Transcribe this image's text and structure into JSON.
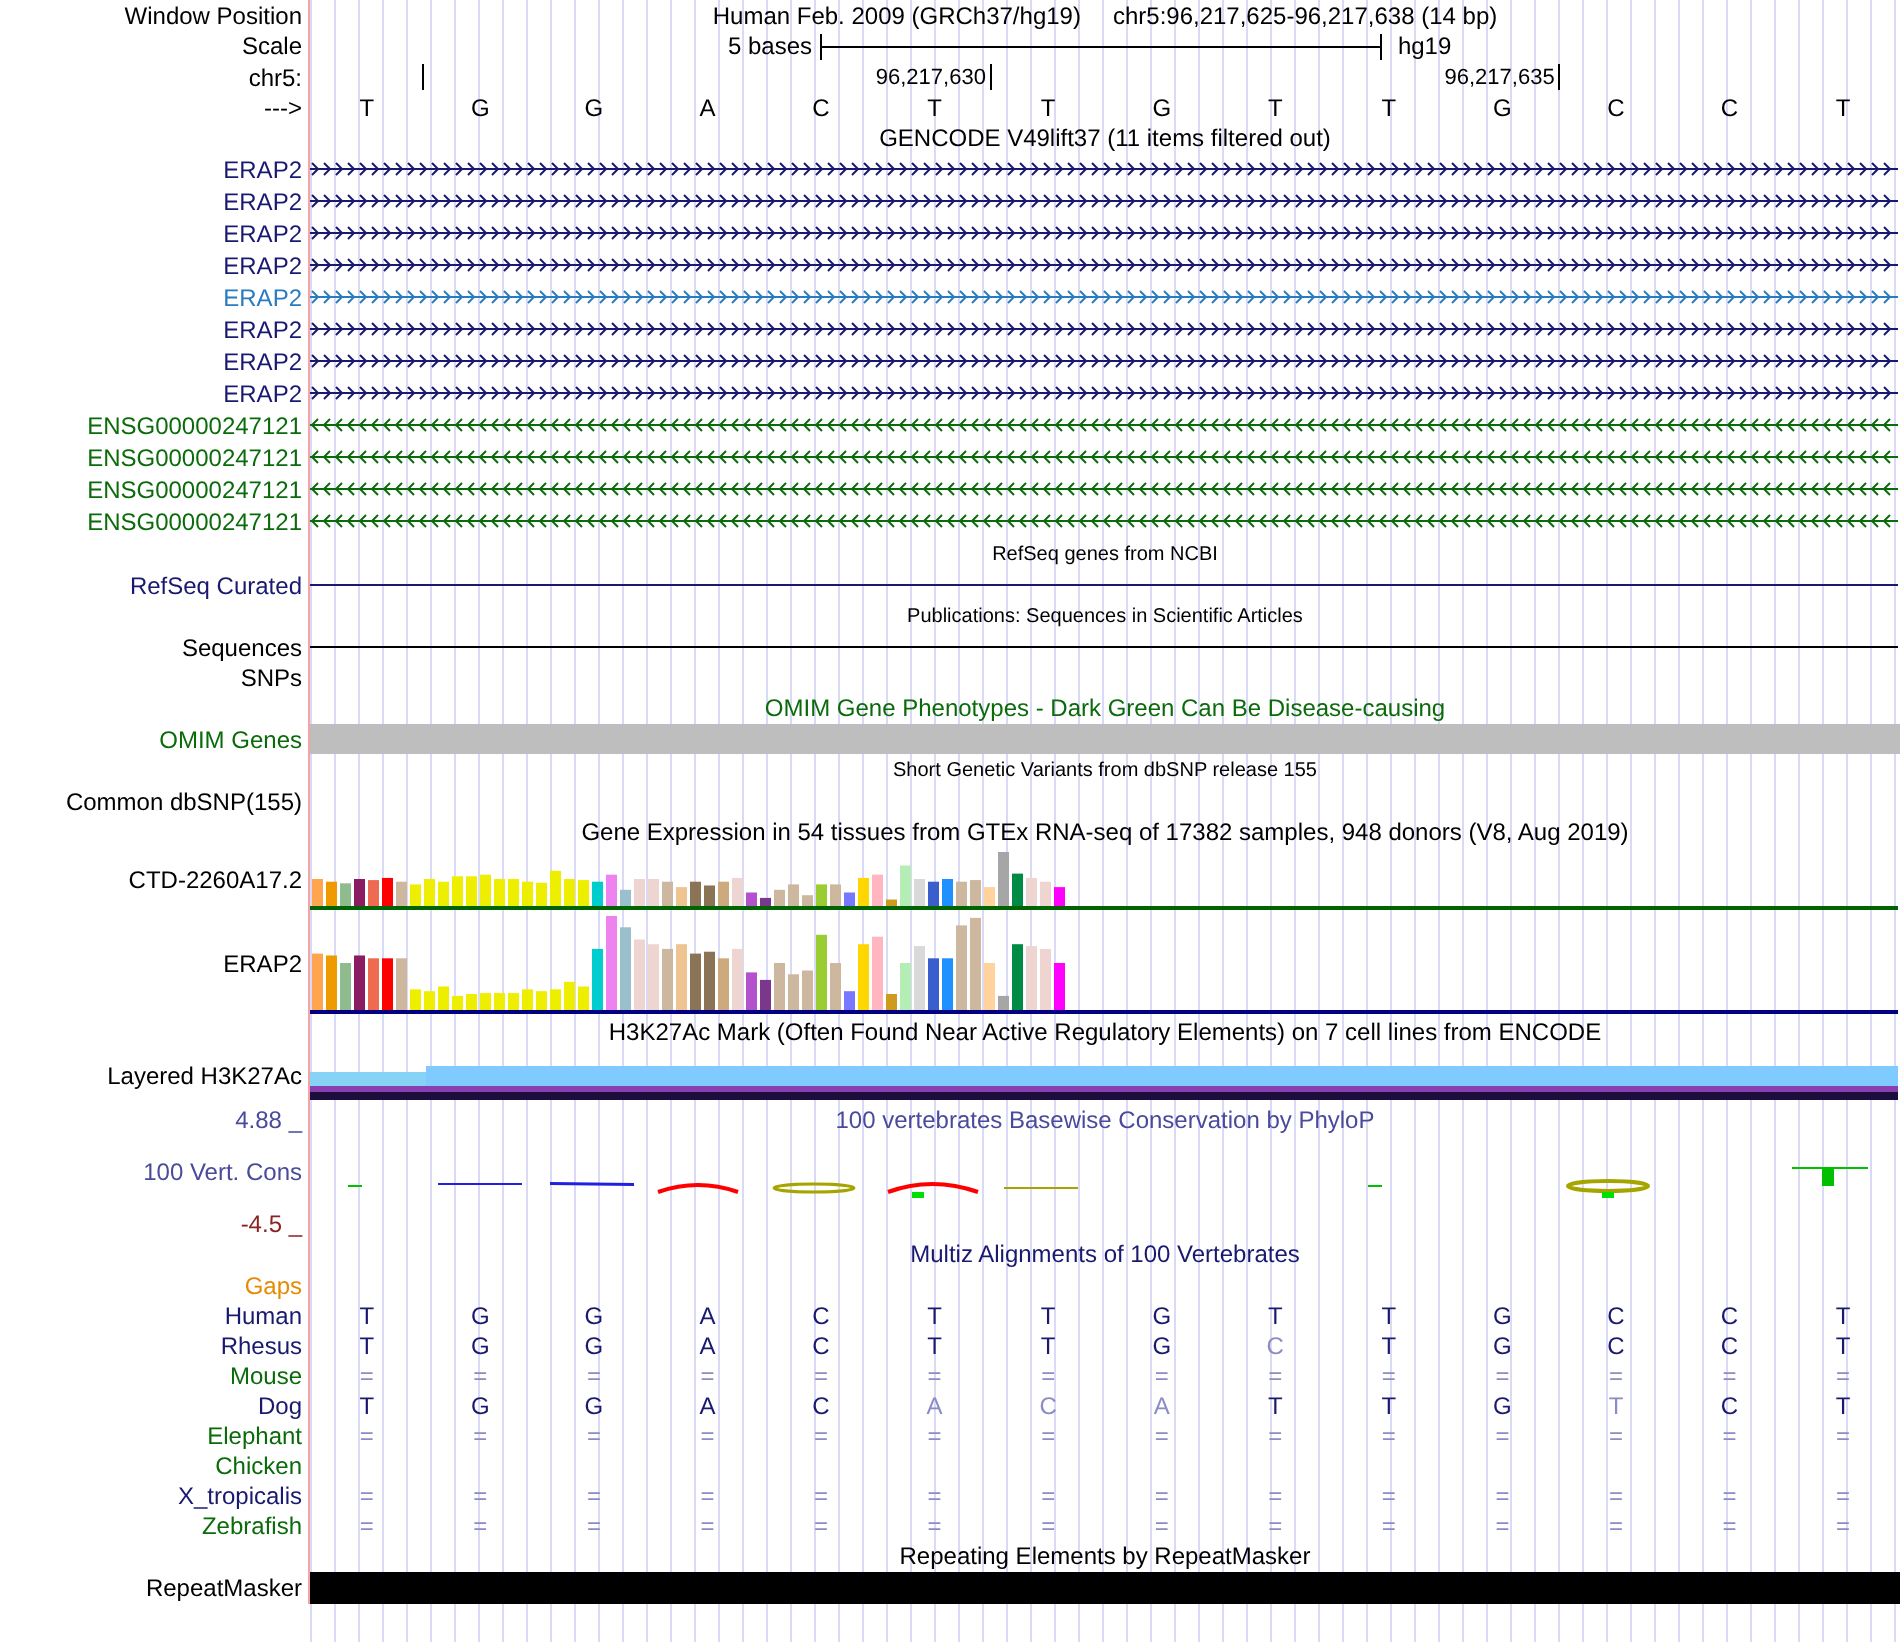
{
  "position": {
    "label": "Window Position",
    "assembly": "Human Feb. 2009 (GRCh37/hg19)",
    "region": "chr5:96,217,625-96,217,638 (14 bp)"
  },
  "scale": {
    "label": "Scale",
    "span": "5 bases",
    "assembly_label": "hg19"
  },
  "ruler": {
    "label": "chr5:",
    "position_labels": [
      "96,217,630",
      "96,217,635"
    ]
  },
  "sequence": {
    "label": "--->",
    "bases": [
      "T",
      "G",
      "G",
      "A",
      "C",
      "T",
      "T",
      "G",
      "T",
      "T",
      "G",
      "C",
      "C",
      "T"
    ]
  },
  "tracks": [
    {
      "title": "GENCODE V49lift37 (11 items filtered out)",
      "color": "#000000",
      "small": false,
      "rows": [
        {
          "kind": "gene",
          "label": "ERAP2",
          "reverse": false,
          "color": "#191970"
        },
        {
          "kind": "gene",
          "label": "ERAP2",
          "reverse": false,
          "color": "#191970"
        },
        {
          "kind": "gene",
          "label": "ERAP2",
          "reverse": false,
          "color": "#191970"
        },
        {
          "kind": "gene",
          "label": "ERAP2",
          "reverse": false,
          "color": "#191970"
        },
        {
          "kind": "gene",
          "label": "ERAP2",
          "reverse": false,
          "color": "#2b7bbf"
        },
        {
          "kind": "gene",
          "label": "ERAP2",
          "reverse": false,
          "color": "#191970"
        },
        {
          "kind": "gene",
          "label": "ERAP2",
          "reverse": false,
          "color": "#191970"
        },
        {
          "kind": "gene",
          "label": "ERAP2",
          "reverse": false,
          "color": "#191970"
        },
        {
          "kind": "gene",
          "label": "ENSG00000247121",
          "reverse": true,
          "color": "#0b6b0b"
        },
        {
          "kind": "gene",
          "label": "ENSG00000247121",
          "reverse": true,
          "color": "#0b6b0b"
        },
        {
          "kind": "gene",
          "label": "ENSG00000247121",
          "reverse": true,
          "color": "#0b6b0b"
        },
        {
          "kind": "gene",
          "label": "ENSG00000247121",
          "reverse": true,
          "color": "#0b6b0b"
        }
      ]
    },
    {
      "title": "RefSeq genes from NCBI",
      "color": "#000000",
      "small": true,
      "rows": [
        {
          "kind": "line",
          "label": "RefSeq Curated",
          "color": "#191970"
        }
      ]
    },
    {
      "title": "Publications: Sequences in Scientific Articles",
      "color": "#000000",
      "small": true,
      "rows": [
        {
          "kind": "line",
          "label": "Sequences",
          "color": "#000000"
        },
        {
          "kind": "empty",
          "label": "SNPs",
          "color": "#000000"
        }
      ]
    },
    {
      "title": "OMIM Gene Phenotypes - Dark Green Can Be Disease-causing",
      "color": "#0b6b0b",
      "small": false,
      "rows": [
        {
          "kind": "bar",
          "label": "OMIM Genes",
          "color": "#0b6b0b"
        }
      ]
    },
    {
      "title": "Short Genetic Variants from dbSNP release 155",
      "color": "#000000",
      "small": true,
      "rows": [
        {
          "kind": "empty",
          "label": "Common dbSNP(155)",
          "color": "#000000"
        }
      ]
    },
    {
      "title": "Gene Expression in 54 tissues from GTEx RNA-seq of 17382 samples, 948 donors (V8, Aug 2019)",
      "color": "#000000",
      "small": false,
      "rows": [
        {
          "kind": "expression",
          "label": "CTD-2260A17.2",
          "color": "#000000"
        },
        {
          "kind": "expression",
          "label": "ERAP2",
          "color": "#000000"
        }
      ]
    },
    {
      "title": "H3K27Ac Mark (Often Found Near Active Regulatory Elements) on 7 cell lines from ENCODE",
      "color": "#000000",
      "small": false,
      "rows": [
        {
          "kind": "layered",
          "label": "Layered H3K27Ac",
          "color": "#000000"
        }
      ]
    },
    {
      "title": "100 vertebrates Basewise Conservation by PhyloP",
      "color": "#4a4a9c",
      "small": false,
      "side_label": {
        "text": "4.88 _",
        "color": "#4a4a9c"
      },
      "rows": [
        {
          "kind": "conservation",
          "label": "100 Vert. Cons",
          "color": "#4a4a9c"
        },
        {
          "kind": "empty",
          "label": "-4.5 _",
          "color": "#8b2323"
        }
      ]
    },
    {
      "title": "Multiz Alignments of 100 Vertebrates",
      "color": "#191970",
      "small": false,
      "rows": [
        {
          "kind": "empty",
          "label": "Gaps",
          "color": "#e68a00"
        },
        {
          "kind": "alignment",
          "label": "Human",
          "color": "#191970",
          "bases": [
            {
              "base": "T",
              "dim": false
            },
            {
              "base": "G",
              "dim": false
            },
            {
              "base": "G",
              "dim": false
            },
            {
              "base": "A",
              "dim": false
            },
            {
              "base": "C",
              "dim": false
            },
            {
              "base": "T",
              "dim": false
            },
            {
              "base": "T",
              "dim": false
            },
            {
              "base": "G",
              "dim": false
            },
            {
              "base": "T",
              "dim": false
            },
            {
              "base": "T",
              "dim": false
            },
            {
              "base": "G",
              "dim": false
            },
            {
              "base": "C",
              "dim": false
            },
            {
              "base": "C",
              "dim": false
            },
            {
              "base": "T",
              "dim": false
            }
          ]
        },
        {
          "kind": "alignment",
          "label": "Rhesus",
          "color": "#191970",
          "bases": [
            {
              "base": "T",
              "dim": false
            },
            {
              "base": "G",
              "dim": false
            },
            {
              "base": "G",
              "dim": false
            },
            {
              "base": "A",
              "dim": false
            },
            {
              "base": "C",
              "dim": false
            },
            {
              "base": "T",
              "dim": false
            },
            {
              "base": "T",
              "dim": false
            },
            {
              "base": "G",
              "dim": false
            },
            {
              "base": "C",
              "dim": true
            },
            {
              "base": "T",
              "dim": false
            },
            {
              "base": "G",
              "dim": false
            },
            {
              "base": "C",
              "dim": false
            },
            {
              "base": "C",
              "dim": false
            },
            {
              "base": "T",
              "dim": false
            }
          ]
        },
        {
          "kind": "alignment",
          "label": "Mouse",
          "color": "#0b6b0b",
          "bases": [
            {
              "base": "=",
              "dim": true
            },
            {
              "base": "=",
              "dim": true
            },
            {
              "base": "=",
              "dim": true
            },
            {
              "base": "=",
              "dim": true
            },
            {
              "base": "=",
              "dim": true
            },
            {
              "base": "=",
              "dim": true
            },
            {
              "base": "=",
              "dim": true
            },
            {
              "base": "=",
              "dim": true
            },
            {
              "base": "=",
              "dim": true
            },
            {
              "base": "=",
              "dim": true
            },
            {
              "base": "=",
              "dim": true
            },
            {
              "base": "=",
              "dim": true
            },
            {
              "base": "=",
              "dim": true
            },
            {
              "base": "=",
              "dim": true
            }
          ]
        },
        {
          "kind": "alignment",
          "label": "Dog",
          "color": "#191970",
          "bases": [
            {
              "base": "T",
              "dim": false
            },
            {
              "base": "G",
              "dim": false
            },
            {
              "base": "G",
              "dim": false
            },
            {
              "base": "A",
              "dim": false
            },
            {
              "base": "C",
              "dim": false
            },
            {
              "base": "A",
              "dim": true
            },
            {
              "base": "C",
              "dim": true
            },
            {
              "base": "A",
              "dim": true
            },
            {
              "base": "T",
              "dim": false
            },
            {
              "base": "T",
              "dim": false
            },
            {
              "base": "G",
              "dim": false
            },
            {
              "base": "T",
              "dim": true
            },
            {
              "base": "C",
              "dim": false
            },
            {
              "base": "T",
              "dim": false
            }
          ]
        },
        {
          "kind": "alignment",
          "label": "Elephant",
          "color": "#0b6b0b",
          "bases": [
            {
              "base": "=",
              "dim": true
            },
            {
              "base": "=",
              "dim": true
            },
            {
              "base": "=",
              "dim": true
            },
            {
              "base": "=",
              "dim": true
            },
            {
              "base": "=",
              "dim": true
            },
            {
              "base": "=",
              "dim": true
            },
            {
              "base": "=",
              "dim": true
            },
            {
              "base": "=",
              "dim": true
            },
            {
              "base": "=",
              "dim": true
            },
            {
              "base": "=",
              "dim": true
            },
            {
              "base": "=",
              "dim": true
            },
            {
              "base": "=",
              "dim": true
            },
            {
              "base": "=",
              "dim": true
            },
            {
              "base": "=",
              "dim": true
            }
          ]
        },
        {
          "kind": "alignment",
          "label": "Chicken",
          "color": "#0b6b0b",
          "bases": []
        },
        {
          "kind": "alignment",
          "label": "X_tropicalis",
          "color": "#191970",
          "bases": [
            {
              "base": "=",
              "dim": true
            },
            {
              "base": "=",
              "dim": true
            },
            {
              "base": "=",
              "dim": true
            },
            {
              "base": "=",
              "dim": true
            },
            {
              "base": "=",
              "dim": true
            },
            {
              "base": "=",
              "dim": true
            },
            {
              "base": "=",
              "dim": true
            },
            {
              "base": "=",
              "dim": true
            },
            {
              "base": "=",
              "dim": true
            },
            {
              "base": "=",
              "dim": true
            },
            {
              "base": "=",
              "dim": true
            },
            {
              "base": "=",
              "dim": true
            },
            {
              "base": "=",
              "dim": true
            },
            {
              "base": "=",
              "dim": true
            }
          ]
        },
        {
          "kind": "alignment",
          "label": "Zebrafish",
          "color": "#0b6b0b",
          "bases": [
            {
              "base": "=",
              "dim": true
            },
            {
              "base": "=",
              "dim": true
            },
            {
              "base": "=",
              "dim": true
            },
            {
              "base": "=",
              "dim": true
            },
            {
              "base": "=",
              "dim": true
            },
            {
              "base": "=",
              "dim": true
            },
            {
              "base": "=",
              "dim": true
            },
            {
              "base": "=",
              "dim": true
            },
            {
              "base": "=",
              "dim": true
            },
            {
              "base": "=",
              "dim": true
            },
            {
              "base": "=",
              "dim": true
            },
            {
              "base": "=",
              "dim": true
            },
            {
              "base": "=",
              "dim": true
            },
            {
              "base": "=",
              "dim": true
            }
          ]
        }
      ]
    },
    {
      "title": "Repeating Elements by RepeatMasker",
      "color": "#000000",
      "small": false,
      "rows": [
        {
          "kind": "solid",
          "label": "RepeatMasker",
          "color": "#000000"
        }
      ]
    }
  ]
}
